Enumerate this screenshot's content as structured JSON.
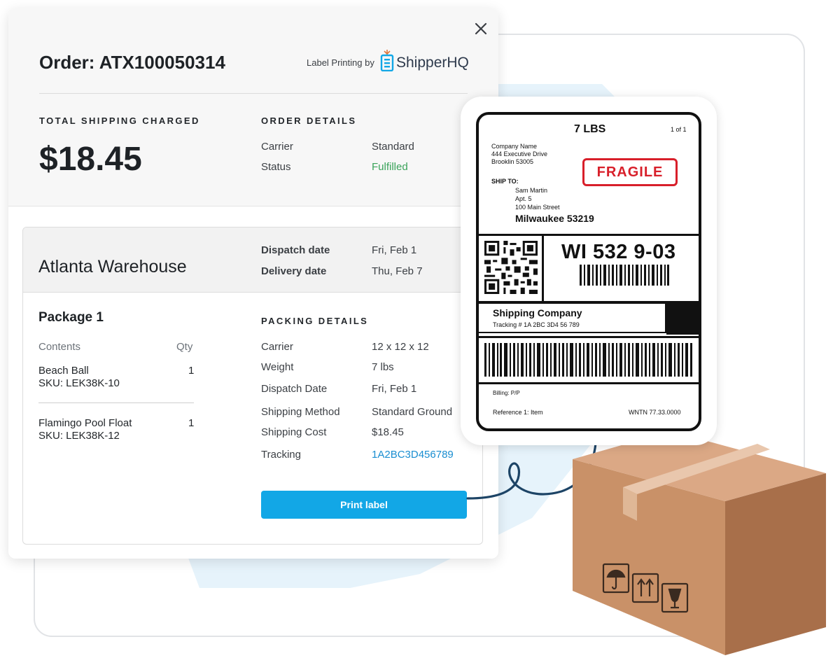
{
  "order": {
    "title": "Order: ATX100050314",
    "label_printing_by": "Label Printing by",
    "brand_name": "ShipperHQ",
    "total_shipping_label": "TOTAL SHIPPING CHARGED",
    "total_shipping_amount": "$18.45",
    "order_details_label": "ORDER DETAILS",
    "carrier_key": "Carrier",
    "carrier_value": "Standard",
    "status_key": "Status",
    "status_value": "Fulfilled"
  },
  "warehouse": {
    "name": "Atlanta Warehouse",
    "dispatch_key": "Dispatch date",
    "dispatch_value": "Fri, Feb 1",
    "delivery_key": "Delivery date",
    "delivery_value": "Thu, Feb 7"
  },
  "package": {
    "title": "Package 1",
    "contents_header": "Contents",
    "qty_header": "Qty",
    "items": [
      {
        "name": "Beach Ball",
        "sku": "SKU: LEK38K-10",
        "qty": "1"
      },
      {
        "name": "Flamingo Pool Float",
        "sku": "SKU: LEK38K-12",
        "qty": "1"
      }
    ]
  },
  "packing": {
    "label": "PACKING DETAILS",
    "rows": [
      {
        "key": "Carrier",
        "value": "12 x 12 x 12"
      },
      {
        "key": "Weight",
        "value": "7 lbs"
      },
      {
        "key": "Dispatch Date",
        "value": "Fri, Feb 1"
      },
      {
        "key": "Shipping Method",
        "value": "Standard Ground"
      },
      {
        "key": "Shipping Cost",
        "value": "$18.45"
      },
      {
        "key": "Tracking",
        "value": "1A2BC3D456789"
      }
    ],
    "print_button": "Print label"
  },
  "shipping_label": {
    "weight": "7 LBS",
    "count": "1 of 1",
    "from_line1": "Company Name",
    "from_line2": "444 Executive Drive",
    "from_line3": "Brooklin 53005",
    "fragile": "FRAGILE",
    "ship_to_heading": "SHIP TO:",
    "ship_to_line1": "Sam Martin",
    "ship_to_line2": "Apt. 5",
    "ship_to_line3": "100 Main Street",
    "ship_to_city": "Milwaukee 53219",
    "route_code": "WI 532 9-03",
    "shipping_company": "Shipping Company",
    "tracking_line": "Tracking # 1A 2BC 3D4 56 789",
    "billing": "Billing: P/P",
    "reference": "Reference 1: Item",
    "wntn": "WNTN 77.33.0000"
  },
  "icons": [
    "close-icon",
    "shipperhq-logo-icon",
    "qr-code",
    "barcode",
    "umbrella-icon",
    "this-way-up-icon",
    "fragile-glass-icon"
  ],
  "colors": {
    "accent_button": "#12a7e6",
    "status_green": "#3aa35a",
    "link_blue": "#1a8ed1",
    "fragile_red": "#d81f2a",
    "arrow_navy": "#1d4466",
    "box_cardboard": "#c99168"
  }
}
